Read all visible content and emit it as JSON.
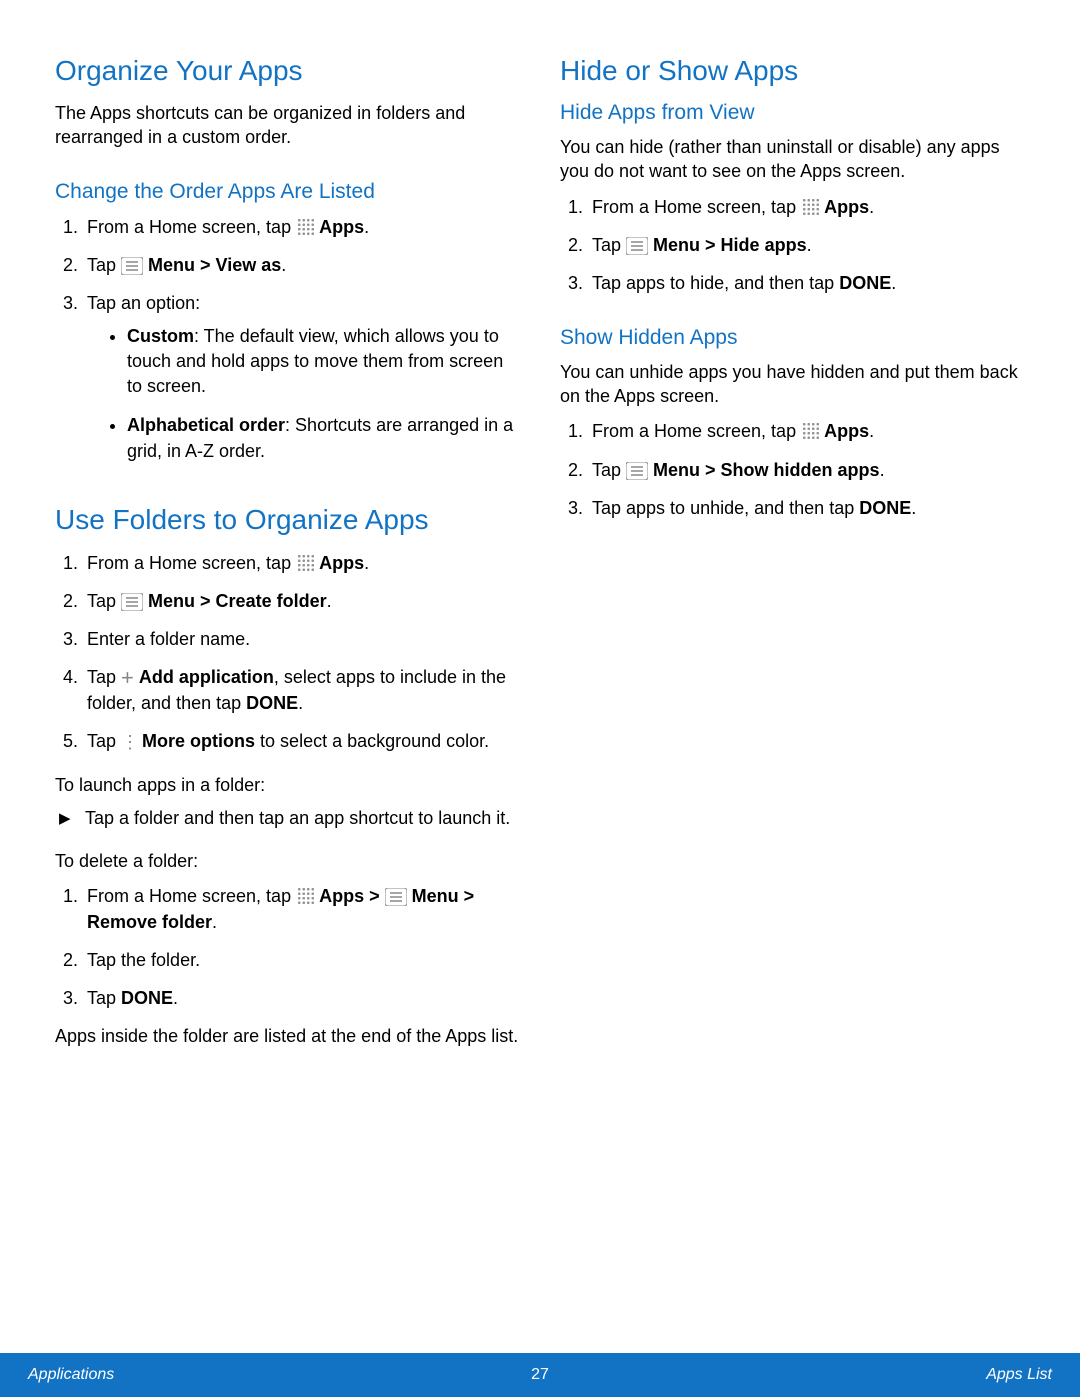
{
  "left": {
    "h_organize": "Organize Your Apps",
    "p_intro": "The Apps shortcuts can be organized in folders and rearranged in a custom order.",
    "h_change": "Change the Order Apps Are Listed",
    "change_s1_a": "From a Home screen, tap ",
    "apps_lbl": "Apps",
    "change_s2_a": "Tap ",
    "change_s2_b": "Menu > View as",
    "change_s3": "Tap an option:",
    "opt_custom_t": "Custom",
    "opt_custom_b": ": The default view, which allows you to touch and hold apps to move them from screen to screen.",
    "opt_alpha_t": "Alphabetical order",
    "opt_alpha_b": ": Shortcuts are arranged in a grid, in A-Z order.",
    "h_folders": "Use Folders to Organize Apps",
    "fold_s1_a": "From a Home screen, tap ",
    "fold_s2_a": "Tap ",
    "fold_s2_b": "Menu > Create folder",
    "fold_s3": "Enter a folder name.",
    "fold_s4_a": "Tap ",
    "fold_s4_b": "Add application",
    "fold_s4_c": ", select apps to include in the folder, and then tap ",
    "done": "DONE",
    "fold_s5_a": "Tap ",
    "fold_s5_b": "More options",
    "fold_s5_c": " to select a background color.",
    "launch_pre": "To launch apps in a folder:",
    "launch_li": "Tap a folder and then tap an app shortcut to launch it.",
    "delete_pre": "To delete a folder:",
    "del_s1_a": "From a Home screen, tap ",
    "del_s1_b": "Apps > ",
    "del_s1_c": "Menu > Remove folder",
    "del_s2": "Tap the folder.",
    "del_s3_a": "Tap ",
    "after": "Apps inside the folder are listed at the end of the Apps list."
  },
  "right": {
    "h_hide": "Hide or Show Apps",
    "h_hide_sub": "Hide Apps from View",
    "hide_intro": "You can hide (rather than uninstall or disable) any apps you do not want to see on the Apps screen.",
    "hide_s1_a": "From a Home screen, tap ",
    "hide_s2_a": "Tap ",
    "hide_s2_b": "Menu > Hide apps",
    "hide_s3_a": "Tap apps to hide, and then tap ",
    "h_show_sub": "Show Hidden Apps",
    "show_intro": "You can unhide apps you have hidden and put them back on the Apps screen.",
    "show_s1_a": "From a Home screen, tap ",
    "show_s2_a": "Tap ",
    "show_s2_b": "Menu > Show hidden apps",
    "show_s3_a": "Tap apps to unhide, and then tap "
  },
  "footer": {
    "left": "Applications",
    "center": "27",
    "right": "Apps List"
  }
}
